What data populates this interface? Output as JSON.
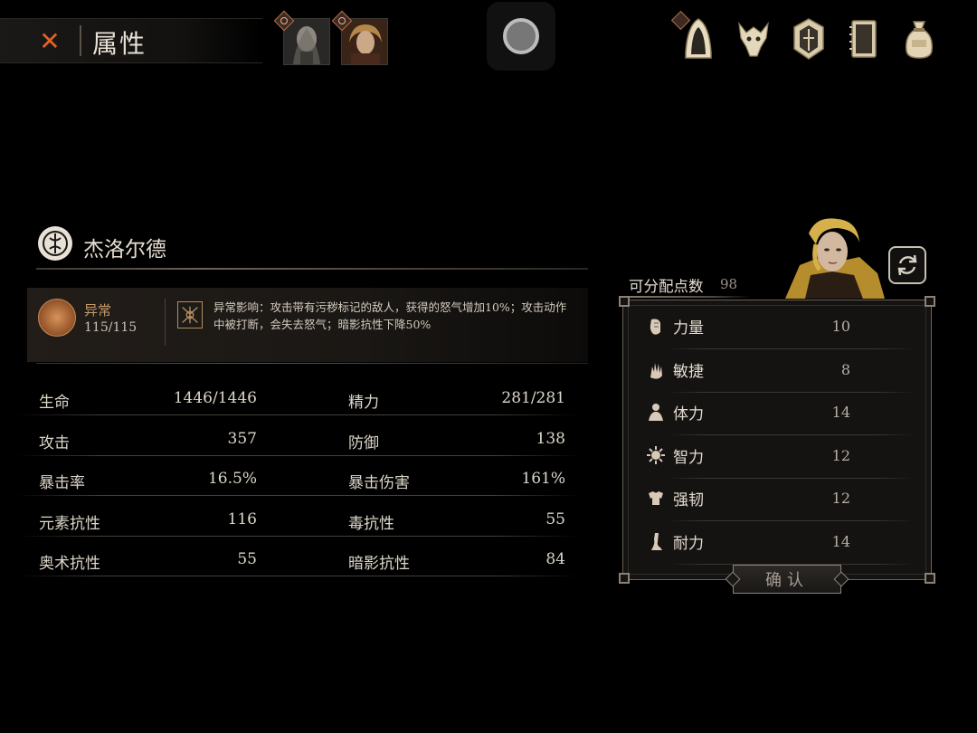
{
  "header": {
    "title": "属性"
  },
  "character": {
    "name": "杰洛尔德"
  },
  "status": {
    "name": "异常",
    "value": "115/115",
    "effect_line1": "异常影响：攻击带有污秽标记的敌人，获得的怒气增加10%；攻击动作",
    "effect_line2": "中被打断，会失去怒气；暗影抗性下降50%"
  },
  "stats": [
    {
      "left_label": "生命",
      "left_value": "1446/1446",
      "right_label": "精力",
      "right_value": "281/281"
    },
    {
      "left_label": "攻击",
      "left_value": "357",
      "right_label": "防御",
      "right_value": "138"
    },
    {
      "left_label": "暴击率",
      "left_value": "16.5%",
      "right_label": "暴击伤害",
      "right_value": "161%"
    },
    {
      "left_label": "元素抗性",
      "left_value": "116",
      "right_label": "毒抗性",
      "right_value": "55"
    },
    {
      "left_label": "奥术抗性",
      "left_value": "55",
      "right_label": "暗影抗性",
      "right_value": "84"
    }
  ],
  "attributes": {
    "points_label": "可分配点数",
    "points_value": "98",
    "items": [
      {
        "label": "力量",
        "value": "10",
        "icon": "fist-icon"
      },
      {
        "label": "敏捷",
        "value": "8",
        "icon": "hand-icon"
      },
      {
        "label": "体力",
        "value": "14",
        "icon": "body-icon"
      },
      {
        "label": "智力",
        "value": "12",
        "icon": "sun-icon"
      },
      {
        "label": "强韧",
        "value": "12",
        "icon": "armor-icon"
      },
      {
        "label": "耐力",
        "value": "14",
        "icon": "leg-icon"
      }
    ],
    "confirm_label": "确认"
  },
  "colors": {
    "accent_orange": "#e0632a",
    "gold": "#c89a6a",
    "background": "#000000"
  }
}
